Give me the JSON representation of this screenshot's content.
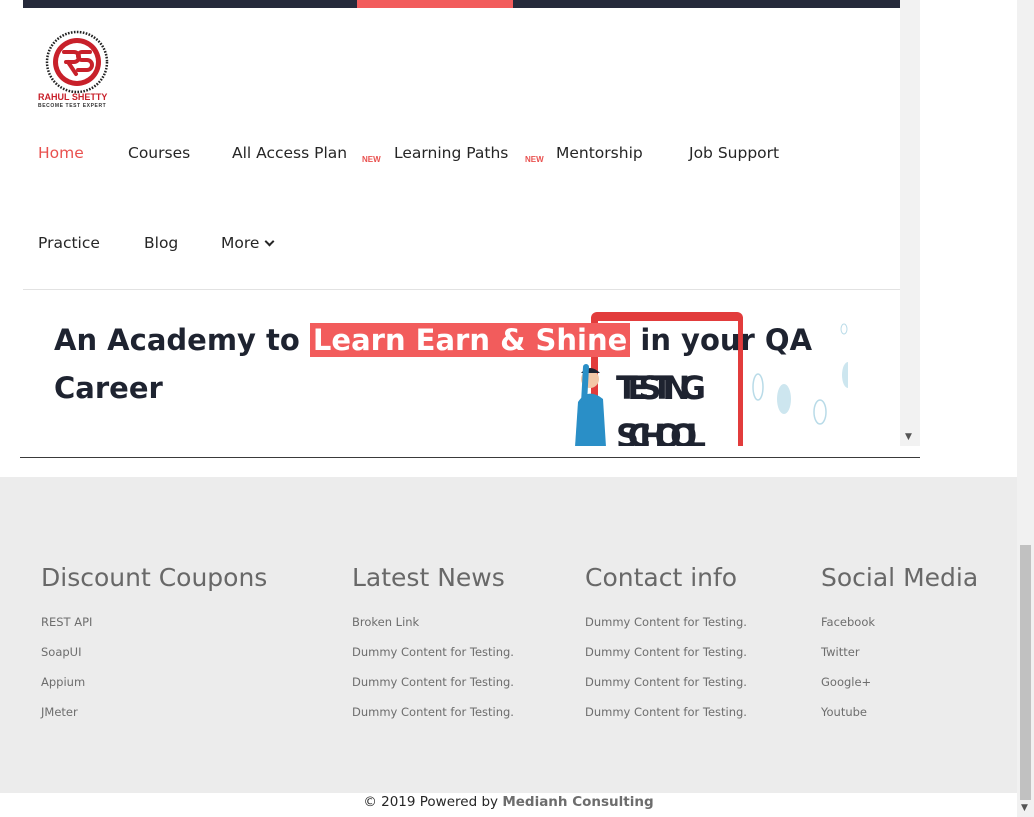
{
  "nav": {
    "items": [
      {
        "label": "Home"
      },
      {
        "label": "Courses"
      },
      {
        "label": "All Access Plan"
      },
      {
        "label": "Learning Paths"
      },
      {
        "label": "Mentorship"
      },
      {
        "label": "Job Support"
      },
      {
        "label": "Practice"
      },
      {
        "label": "Blog"
      },
      {
        "label": "More"
      }
    ],
    "badge": "NEW"
  },
  "logo": {
    "name": "RAHUL SHETTY",
    "tagline": "BECOME TEST EXPERT",
    "brand_color": "#c8202a"
  },
  "hero": {
    "pre": "An Academy to ",
    "highlight": "Learn Earn & Shine",
    "post": " in your QA Career",
    "image_text_1": "TESTING",
    "image_text_2": "SCHOOL"
  },
  "footer": {
    "columns": [
      {
        "title": "Discount Coupons",
        "links": [
          "REST API",
          "SoapUI",
          "Appium",
          "JMeter"
        ]
      },
      {
        "title": "Latest News",
        "links": [
          "Broken Link",
          "Dummy Content for Testing.",
          "Dummy Content for Testing.",
          "Dummy Content for Testing."
        ]
      },
      {
        "title": "Contact info",
        "links": [
          "Dummy Content for Testing.",
          "Dummy Content for Testing.",
          "Dummy Content for Testing.",
          "Dummy Content for Testing."
        ]
      },
      {
        "title": "Social Media",
        "links": [
          "Facebook",
          "Twitter",
          "Google+",
          "Youtube"
        ]
      }
    ],
    "copyright_prefix": "© 2019 Powered by ",
    "copyright_company": "Medianh Consulting"
  },
  "colors": {
    "accent": "#f25c5c",
    "topbar": "#262a3b",
    "footer_bg": "#ececec"
  }
}
